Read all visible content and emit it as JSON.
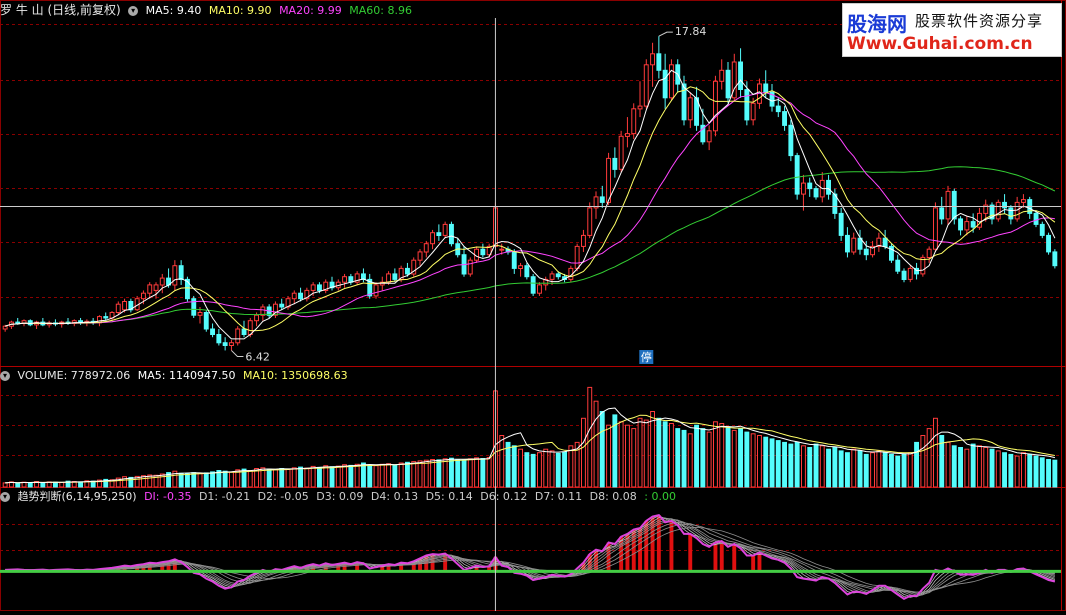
{
  "main_header": {
    "title": "罗 牛 山 (日线,前复权)",
    "ma5": "MA5: 9.40",
    "ma10": "MA10: 9.90",
    "ma20": "MA20: 9.99",
    "ma60": "MA60: 8.96"
  },
  "volume_header": {
    "title": "VOLUME: 778972.06",
    "ma5": "MA5: 1140947.50",
    "ma10": "MA10: 1350698.63"
  },
  "indicator_header": {
    "title": "趋势判断(6,14,95,250)",
    "di": "DI: -0.35",
    "d1": "D1: -0.21",
    "d2": "D2: -0.05",
    "d3": "D3: 0.09",
    "d4": "D4: 0.13",
    "d5": "D5: 0.14",
    "d6": "D6: 0.12",
    "d7": "D7: 0.11",
    "d8": "D8: 0.08",
    "extra": ": 0.00"
  },
  "annotations": {
    "high": "17.84",
    "low": "6.42",
    "limit_mark": "停"
  },
  "logo": {
    "brand": "股海网",
    "slogan": "股票软件资源分享",
    "url": "Www.Guhai.com.cn"
  },
  "colors": {
    "up": "#ff3b3b",
    "down": "#54fcfc",
    "ma5": "#ffffff",
    "ma10": "#ffff66",
    "ma20": "#ff44ff",
    "ma60": "#33cc33",
    "grid": "#8a0000",
    "crosshair": "#cccccc",
    "macd_line": "#dd44dd",
    "zero_line": "#44cc44"
  },
  "chart_data": {
    "type": "candlestick",
    "price_range": [
      6.0,
      18.5
    ],
    "crosshair_index": 78,
    "high_index": 104,
    "low_index": 36,
    "candles": [
      [
        7.2,
        7.35,
        7.1,
        7.3
      ],
      [
        7.3,
        7.5,
        7.2,
        7.45
      ],
      [
        7.45,
        7.6,
        7.35,
        7.4
      ],
      [
        7.4,
        7.55,
        7.3,
        7.5
      ],
      [
        7.5,
        7.55,
        7.3,
        7.35
      ],
      [
        7.35,
        7.5,
        7.2,
        7.45
      ],
      [
        7.45,
        7.6,
        7.3,
        7.35
      ],
      [
        7.35,
        7.5,
        7.25,
        7.42
      ],
      [
        7.42,
        7.55,
        7.3,
        7.38
      ],
      [
        7.38,
        7.5,
        7.25,
        7.45
      ],
      [
        7.45,
        7.6,
        7.35,
        7.4
      ],
      [
        7.4,
        7.55,
        7.3,
        7.5
      ],
      [
        7.5,
        7.6,
        7.35,
        7.42
      ],
      [
        7.42,
        7.55,
        7.3,
        7.48
      ],
      [
        7.48,
        7.6,
        7.35,
        7.42
      ],
      [
        7.42,
        7.7,
        7.3,
        7.65
      ],
      [
        7.65,
        7.8,
        7.5,
        7.6
      ],
      [
        7.6,
        7.85,
        7.5,
        7.8
      ],
      [
        7.8,
        8.2,
        7.7,
        8.1
      ],
      [
        7.9,
        8.3,
        7.8,
        8.2
      ],
      [
        8.2,
        8.3,
        7.8,
        7.9
      ],
      [
        7.9,
        8.4,
        7.85,
        8.3
      ],
      [
        8.3,
        8.6,
        8.1,
        8.5
      ],
      [
        8.5,
        8.9,
        8.3,
        8.8
      ],
      [
        8.6,
        8.9,
        8.3,
        8.8
      ],
      [
        8.8,
        9.2,
        8.5,
        9.05
      ],
      [
        9.05,
        9.4,
        8.7,
        8.8
      ],
      [
        8.8,
        9.7,
        8.6,
        9.5
      ],
      [
        9.5,
        9.7,
        8.8,
        9.0
      ],
      [
        9.0,
        9.1,
        8.2,
        8.3
      ],
      [
        8.3,
        8.4,
        7.6,
        7.7
      ],
      [
        7.7,
        8.0,
        7.4,
        7.8
      ],
      [
        7.8,
        7.9,
        7.1,
        7.2
      ],
      [
        7.2,
        7.4,
        6.9,
        7.0
      ],
      [
        7.0,
        7.2,
        6.6,
        6.7
      ],
      [
        6.7,
        6.9,
        6.42,
        6.6
      ],
      [
        6.6,
        6.8,
        6.42,
        6.7
      ],
      [
        6.7,
        7.3,
        6.6,
        7.2
      ],
      [
        7.2,
        7.5,
        6.9,
        7.0
      ],
      [
        7.0,
        7.6,
        6.9,
        7.5
      ],
      [
        7.5,
        7.8,
        7.3,
        7.7
      ],
      [
        7.7,
        8.1,
        7.5,
        8.0
      ],
      [
        8.0,
        8.1,
        7.6,
        7.7
      ],
      [
        7.7,
        8.2,
        7.6,
        8.1
      ],
      [
        8.1,
        8.3,
        7.9,
        8.0
      ],
      [
        8.0,
        8.4,
        7.9,
        8.3
      ],
      [
        8.3,
        8.6,
        8.1,
        8.5
      ],
      [
        8.5,
        8.7,
        8.2,
        8.3
      ],
      [
        8.3,
        8.7,
        8.2,
        8.6
      ],
      [
        8.6,
        8.9,
        8.4,
        8.8
      ],
      [
        8.8,
        8.9,
        8.5,
        8.6
      ],
      [
        8.6,
        9.0,
        8.5,
        8.9
      ],
      [
        8.9,
        9.1,
        8.6,
        8.7
      ],
      [
        8.7,
        9.0,
        8.6,
        8.9
      ],
      [
        8.9,
        9.2,
        8.7,
        9.1
      ],
      [
        9.1,
        9.2,
        8.8,
        8.9
      ],
      [
        8.9,
        9.3,
        8.8,
        9.2
      ],
      [
        9.2,
        9.4,
        8.9,
        9.0
      ],
      [
        9.0,
        9.2,
        8.3,
        8.4
      ],
      [
        8.4,
        8.9,
        8.3,
        8.8
      ],
      [
        8.8,
        9.1,
        8.6,
        8.9
      ],
      [
        8.9,
        9.3,
        8.8,
        9.2
      ],
      [
        9.2,
        9.4,
        8.9,
        9.0
      ],
      [
        9.0,
        9.5,
        8.9,
        9.4
      ],
      [
        9.4,
        9.6,
        9.1,
        9.2
      ],
      [
        9.2,
        9.8,
        9.1,
        9.7
      ],
      [
        9.7,
        10.1,
        9.5,
        10.0
      ],
      [
        10.0,
        10.4,
        9.8,
        10.3
      ],
      [
        10.3,
        10.8,
        10.1,
        10.7
      ],
      [
        10.7,
        11.0,
        10.4,
        10.6
      ],
      [
        10.6,
        11.1,
        10.5,
        11.0
      ],
      [
        11.0,
        11.1,
        10.2,
        10.3
      ],
      [
        10.3,
        10.5,
        9.8,
        9.9
      ],
      [
        9.9,
        10.2,
        9.1,
        9.2
      ],
      [
        9.2,
        9.8,
        9.1,
        9.7
      ],
      [
        9.7,
        10.2,
        9.6,
        10.1
      ],
      [
        10.1,
        10.3,
        9.8,
        9.9
      ],
      [
        9.9,
        10.3,
        9.8,
        10.2
      ],
      [
        10.2,
        11.8,
        10.2,
        11.6
      ],
      [
        10.1,
        10.3,
        9.9,
        10.1
      ],
      [
        10.1,
        10.2,
        9.9,
        10.0
      ],
      [
        10.0,
        10.1,
        9.2,
        9.4
      ],
      [
        9.4,
        9.6,
        9.1,
        9.5
      ],
      [
        9.5,
        9.6,
        9.0,
        9.1
      ],
      [
        9.1,
        9.2,
        8.4,
        8.5
      ],
      [
        8.5,
        8.9,
        8.4,
        8.8
      ],
      [
        8.8,
        9.1,
        8.6,
        9.0
      ],
      [
        9.0,
        9.3,
        8.8,
        9.2
      ],
      [
        9.2,
        9.3,
        9.0,
        9.1
      ],
      [
        9.1,
        9.2,
        8.9,
        9.0
      ],
      [
        9.0,
        9.5,
        8.9,
        9.4
      ],
      [
        9.4,
        10.3,
        9.3,
        10.2
      ],
      [
        10.2,
        10.8,
        10.0,
        10.6
      ],
      [
        10.6,
        11.8,
        10.5,
        11.6
      ],
      [
        11.6,
        12.2,
        11.2,
        12.0
      ],
      [
        12.0,
        12.4,
        11.6,
        11.8
      ],
      [
        11.8,
        13.6,
        11.7,
        13.4
      ],
      [
        13.4,
        13.8,
        12.7,
        13.0
      ],
      [
        13.0,
        14.4,
        12.9,
        14.2
      ],
      [
        14.2,
        14.9,
        13.8,
        14.3
      ],
      [
        14.3,
        15.4,
        14.1,
        15.2
      ],
      [
        15.2,
        16.2,
        14.9,
        15.3
      ],
      [
        15.3,
        17.0,
        15.2,
        16.8
      ],
      [
        16.8,
        17.6,
        16.0,
        17.2
      ],
      [
        17.2,
        17.84,
        16.3,
        16.6
      ],
      [
        16.6,
        17.2,
        15.2,
        15.6
      ],
      [
        15.6,
        17.0,
        15.5,
        16.8
      ],
      [
        16.8,
        17.0,
        15.8,
        16.1
      ],
      [
        16.1,
        16.4,
        14.6,
        14.8
      ],
      [
        14.8,
        15.8,
        14.5,
        15.6
      ],
      [
        15.6,
        16.0,
        14.4,
        14.6
      ],
      [
        14.6,
        15.2,
        13.9,
        14.0
      ],
      [
        14.0,
        14.6,
        13.7,
        14.4
      ],
      [
        14.4,
        16.4,
        14.2,
        16.2
      ],
      [
        16.2,
        17.0,
        15.9,
        16.6
      ],
      [
        16.6,
        16.9,
        15.4,
        15.6
      ],
      [
        15.6,
        17.2,
        15.5,
        16.9
      ],
      [
        16.9,
        17.4,
        15.6,
        15.9
      ],
      [
        15.9,
        16.2,
        14.6,
        14.8
      ],
      [
        14.8,
        15.6,
        14.6,
        15.4
      ],
      [
        15.4,
        16.3,
        15.2,
        16.1
      ],
      [
        16.1,
        16.6,
        15.6,
        15.8
      ],
      [
        15.8,
        16.1,
        15.1,
        15.3
      ],
      [
        15.3,
        15.6,
        14.9,
        15.1
      ],
      [
        15.1,
        15.3,
        14.4,
        14.6
      ],
      [
        14.6,
        14.8,
        13.3,
        13.5
      ],
      [
        13.5,
        13.6,
        11.9,
        12.1
      ],
      [
        12.1,
        12.8,
        11.5,
        12.5
      ],
      [
        12.5,
        12.7,
        12.0,
        12.3
      ],
      [
        12.3,
        12.4,
        11.9,
        12.0
      ],
      [
        12.0,
        12.9,
        11.8,
        12.6
      ],
      [
        12.6,
        12.8,
        11.9,
        12.1
      ],
      [
        12.1,
        12.3,
        11.2,
        11.4
      ],
      [
        11.4,
        11.6,
        10.4,
        10.6
      ],
      [
        10.6,
        10.9,
        9.8,
        10.0
      ],
      [
        10.0,
        10.7,
        9.9,
        10.5
      ],
      [
        10.5,
        10.8,
        9.9,
        10.1
      ],
      [
        10.1,
        10.4,
        9.7,
        9.9
      ],
      [
        9.9,
        10.4,
        9.8,
        10.2
      ],
      [
        10.2,
        10.7,
        10.0,
        10.5
      ],
      [
        10.5,
        10.8,
        10.1,
        10.2
      ],
      [
        10.2,
        10.3,
        9.6,
        9.7
      ],
      [
        9.7,
        9.9,
        9.2,
        9.3
      ],
      [
        9.3,
        9.4,
        8.9,
        9.0
      ],
      [
        9.0,
        9.5,
        8.9,
        9.4
      ],
      [
        9.4,
        9.6,
        9.0,
        9.2
      ],
      [
        9.2,
        9.9,
        9.1,
        9.8
      ],
      [
        9.8,
        10.2,
        9.6,
        10.1
      ],
      [
        10.1,
        11.8,
        10.0,
        11.6
      ],
      [
        11.6,
        12.0,
        11.0,
        11.2
      ],
      [
        11.2,
        12.4,
        11.0,
        12.2
      ],
      [
        12.2,
        12.3,
        11.0,
        11.2
      ],
      [
        11.2,
        11.3,
        10.6,
        10.8
      ],
      [
        10.8,
        11.3,
        10.6,
        11.1
      ],
      [
        11.1,
        11.4,
        10.7,
        10.9
      ],
      [
        10.9,
        11.6,
        10.8,
        11.4
      ],
      [
        11.4,
        11.9,
        11.1,
        11.7
      ],
      [
        11.7,
        11.8,
        11.0,
        11.2
      ],
      [
        11.2,
        11.9,
        11.1,
        11.8
      ],
      [
        11.8,
        12.1,
        11.4,
        11.6
      ],
      [
        11.6,
        11.7,
        11.0,
        11.2
      ],
      [
        11.2,
        12.0,
        11.1,
        11.8
      ],
      [
        11.8,
        12.1,
        11.6,
        11.9
      ],
      [
        11.9,
        12.0,
        11.2,
        11.4
      ],
      [
        11.4,
        11.5,
        10.9,
        11.0
      ],
      [
        11.0,
        11.1,
        10.5,
        10.6
      ],
      [
        10.6,
        10.7,
        9.9,
        10.0
      ],
      [
        10.0,
        10.1,
        9.4,
        9.5
      ]
    ],
    "volume_range": [
      0,
      3000000
    ],
    "volumes": [
      120000,
      150000,
      110000,
      140000,
      130000,
      160000,
      120000,
      150000,
      140000,
      130000,
      170000,
      160000,
      150000,
      180000,
      170000,
      200000,
      220000,
      210000,
      260000,
      300000,
      280000,
      310000,
      330000,
      350000,
      340000,
      380000,
      420000,
      460000,
      400000,
      380000,
      420000,
      390000,
      410000,
      440000,
      480000,
      460000,
      430000,
      500000,
      520000,
      480000,
      540000,
      560000,
      520000,
      500000,
      540000,
      510000,
      560000,
      580000,
      550000,
      600000,
      570000,
      620000,
      590000,
      610000,
      650000,
      630000,
      660000,
      700000,
      640000,
      620000,
      660000,
      680000,
      640000,
      700000,
      720000,
      740000,
      760000,
      780000,
      800000,
      790000,
      820000,
      840000,
      800000,
      780000,
      820000,
      850000,
      830000,
      860000,
      2800000,
      1500000,
      1300000,
      1200000,
      1100000,
      1000000,
      950000,
      1000000,
      1100000,
      1050000,
      980000,
      1020000,
      1200000,
      1300000,
      2000000,
      2900000,
      2500000,
      2200000,
      1800000,
      2100000,
      1900000,
      1800000,
      1700000,
      2000000,
      1950000,
      2200000,
      2000000,
      1900000,
      1850000,
      1700000,
      1650000,
      1550000,
      1800000,
      1700000,
      1600000,
      1900000,
      1850000,
      1750000,
      1650000,
      1700000,
      1600000,
      1550000,
      1500000,
      1450000,
      1400000,
      1350000,
      1300000,
      1250000,
      1300000,
      1200000,
      1150000,
      1250000,
      1200000,
      1100000,
      1150000,
      1050000,
      1000000,
      1100000,
      1050000,
      950000,
      1000000,
      1050000,
      1000000,
      950000,
      900000,
      950000,
      1000000,
      1300000,
      1500000,
      1700000,
      2000000,
      1500000,
      1300000,
      1200000,
      1150000,
      1100000,
      1250000,
      1200000,
      1150000,
      1100000,
      1050000,
      1000000,
      950000,
      900000,
      1000000,
      950000,
      900000,
      850000,
      800000,
      780000
    ],
    "indicator_range": [
      -1.2,
      2.3
    ],
    "di": [
      0.05,
      0.06,
      0.07,
      0.05,
      0.04,
      0.05,
      0.06,
      0.04,
      0.05,
      0.06,
      0.07,
      0.05,
      0.04,
      0.06,
      0.05,
      0.08,
      0.1,
      0.12,
      0.16,
      0.2,
      0.18,
      0.22,
      0.25,
      0.3,
      0.28,
      0.32,
      0.35,
      0.42,
      0.32,
      0.15,
      -0.05,
      -0.1,
      -0.25,
      -0.35,
      -0.5,
      -0.6,
      -0.55,
      -0.35,
      -0.3,
      -0.15,
      -0.05,
      0.05,
      -0.02,
      0.08,
      0.05,
      0.12,
      0.18,
      0.12,
      0.2,
      0.25,
      0.2,
      0.28,
      0.22,
      0.26,
      0.3,
      0.25,
      0.32,
      0.28,
      0.1,
      0.15,
      0.2,
      0.25,
      0.22,
      0.3,
      0.28,
      0.35,
      0.45,
      0.55,
      0.6,
      0.58,
      0.62,
      0.45,
      0.25,
      0.05,
      0.12,
      0.2,
      0.15,
      0.18,
      0.5,
      0.2,
      0.15,
      -0.05,
      -0.08,
      -0.15,
      -0.3,
      -0.25,
      -0.2,
      -0.12,
      -0.15,
      -0.18,
      -0.1,
      0.1,
      0.3,
      0.6,
      0.75,
      0.7,
      1.0,
      0.95,
      1.2,
      1.3,
      1.45,
      1.5,
      1.75,
      1.9,
      1.95,
      1.7,
      1.75,
      1.6,
      1.3,
      1.3,
      1.15,
      0.95,
      0.85,
      1.0,
      1.05,
      0.85,
      0.95,
      0.8,
      0.55,
      0.55,
      0.65,
      0.55,
      0.45,
      0.4,
      0.3,
      0.1,
      -0.2,
      -0.25,
      -0.28,
      -0.32,
      -0.2,
      -0.25,
      -0.4,
      -0.6,
      -0.8,
      -0.7,
      -0.72,
      -0.78,
      -0.65,
      -0.5,
      -0.5,
      -0.65,
      -0.8,
      -0.95,
      -0.85,
      -0.85,
      -0.6,
      -0.4,
      0.05,
      0.0,
      0.1,
      0.0,
      -0.12,
      -0.1,
      -0.12,
      -0.05,
      0.05,
      -0.05,
      0.05,
      0.05,
      -0.02,
      0.08,
      0.1,
      0.0,
      -0.1,
      -0.2,
      -0.3,
      -0.35
    ]
  }
}
